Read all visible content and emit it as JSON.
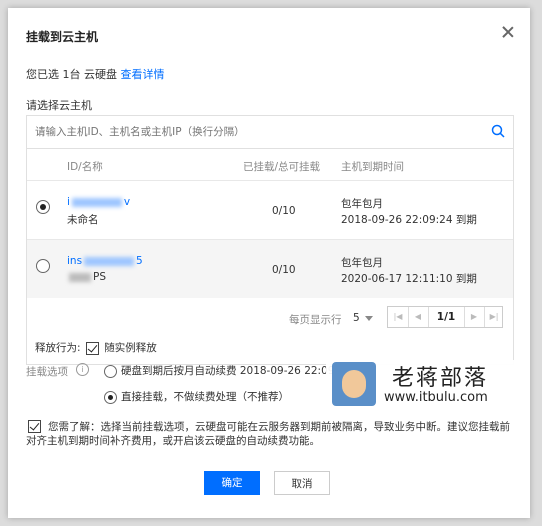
{
  "modal": {
    "title": "挂载到云主机"
  },
  "selection": {
    "prefix": "您已选 1台 云硬盘 ",
    "link": "查看详情"
  },
  "section_label": "请选择云主机",
  "search": {
    "placeholder": "请输入主机ID、主机名或主机IP（换行分隔）"
  },
  "table": {
    "columns": [
      "ID/名称",
      "已挂载/总可挂载",
      "主机到期时间"
    ],
    "rows": [
      {
        "id_prefix": "i",
        "id_suffix": "v",
        "name": "未命名",
        "count": "0/10",
        "billing": "包年包月",
        "expire": "2018-09-26 22:09:24 到期",
        "selected": true
      },
      {
        "id_prefix": "ins",
        "id_suffix": "5",
        "name": "PS",
        "count": "0/10",
        "billing": "包年包月",
        "expire": "2020-06-17 12:11:10 到期",
        "selected": false
      }
    ]
  },
  "pager": {
    "per_page_label": "每页显示行",
    "per_page": "5",
    "page": "1/1"
  },
  "release": {
    "label": "释放行为:",
    "option": "随实例释放"
  },
  "mount": {
    "label": "挂载选项",
    "option1": "硬盘到期后按月自动续费 2018-09-26 22:09",
    "option2": "直接挂载，不做续费处理（不推荐）"
  },
  "watermark": {
    "title": "老蒋部落",
    "url": "www.itbulu.com"
  },
  "notice": {
    "line1": "您需了解：选择当前挂载选项，云硬盘可能在云服务器到期前被隔离，导致业务中断。建议您挂载前",
    "line2": "对齐主机到期时间补齐费用，或开启该云硬盘的自动续费功能。"
  },
  "buttons": {
    "ok": "确定",
    "cancel": "取消"
  },
  "colors": {
    "accent": "#006eff"
  }
}
